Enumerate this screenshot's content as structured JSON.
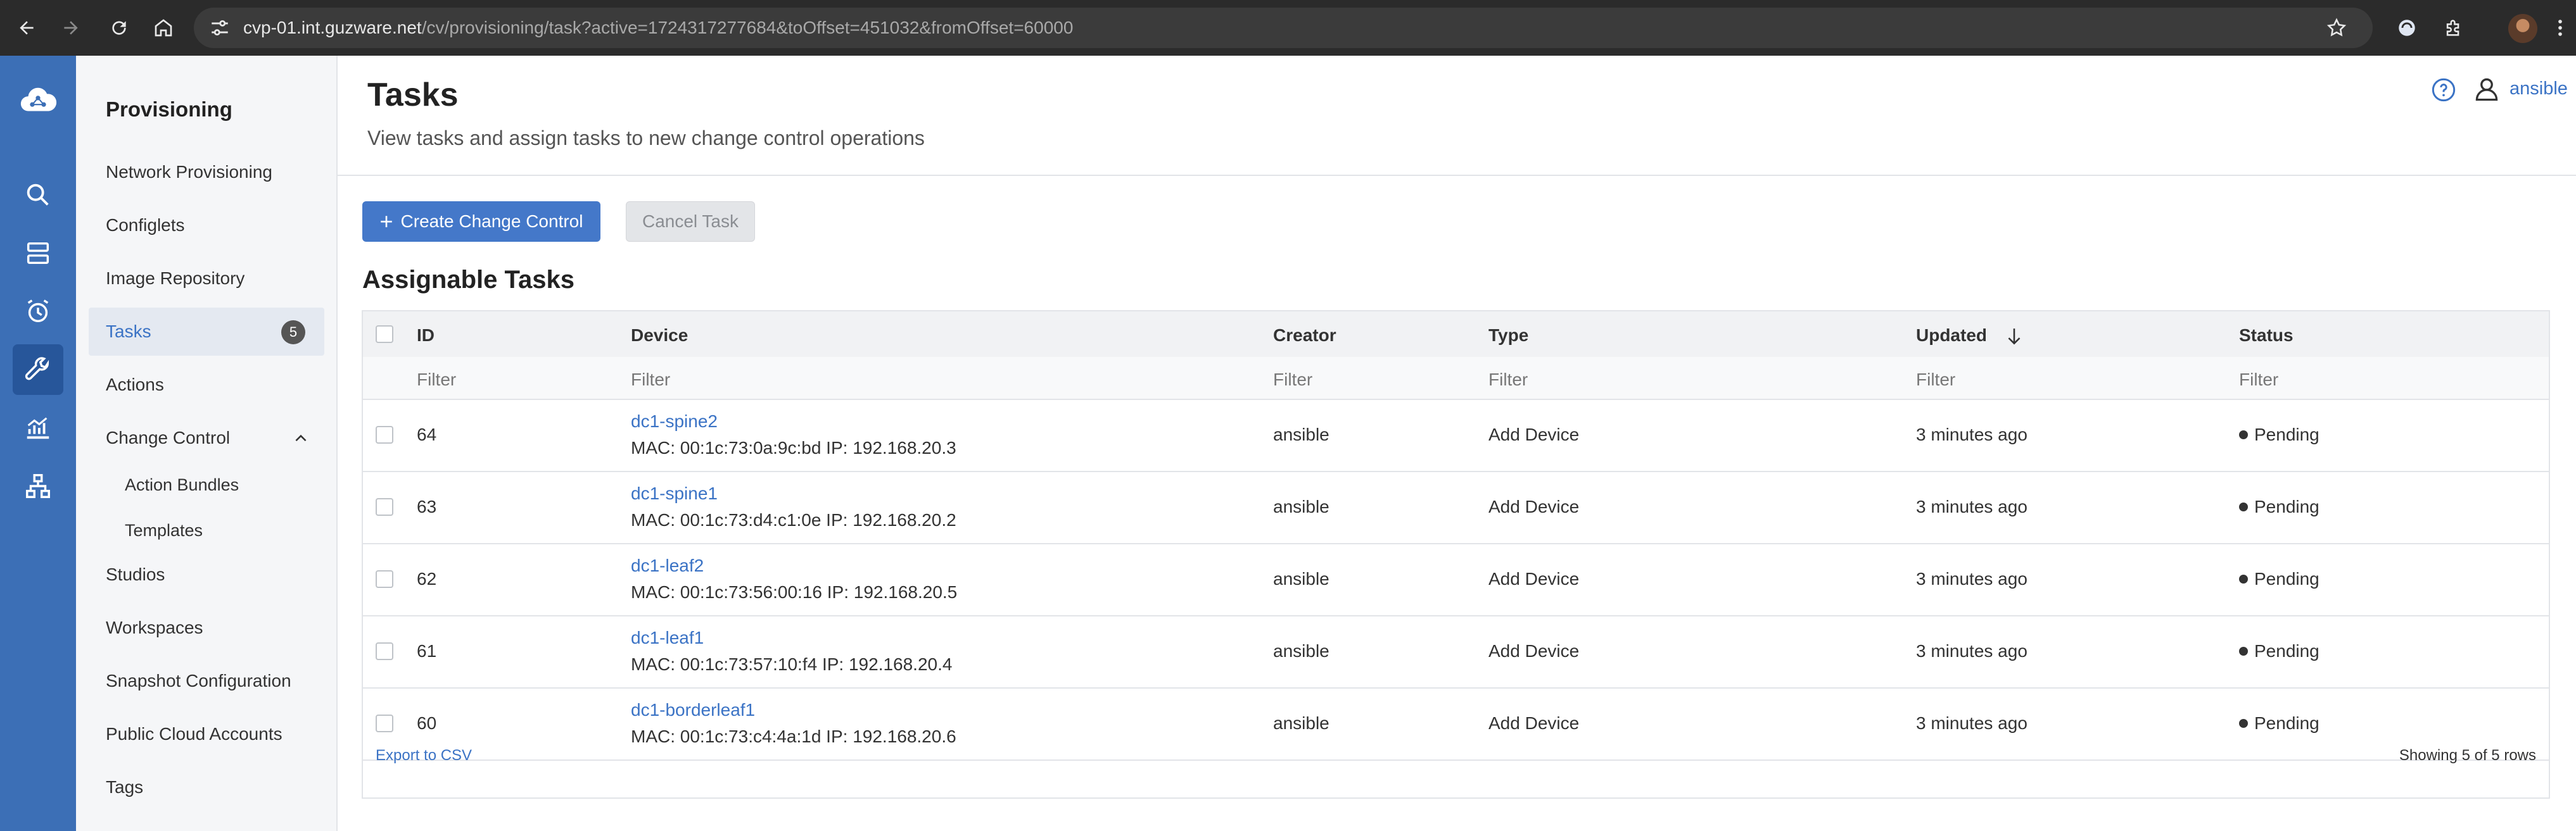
{
  "browser": {
    "url_host": "cvp-01.int.guzware.net",
    "url_path": "/cv/provisioning/task?active=1724317277684&toOffset=451032&fromOffset=60000"
  },
  "rail": {
    "icons": [
      "cloud-logo-icon",
      "search-icon",
      "devices-icon",
      "alarm-clock-icon",
      "wrench-icon",
      "metrics-icon",
      "topology-icon"
    ]
  },
  "sidebar": {
    "title": "Provisioning",
    "items": [
      {
        "label": "Network Provisioning"
      },
      {
        "label": "Configlets"
      },
      {
        "label": "Image Repository"
      },
      {
        "label": "Tasks",
        "badge": "5"
      },
      {
        "label": "Actions"
      },
      {
        "label": "Change Control"
      },
      {
        "label": "Action Bundles"
      },
      {
        "label": "Templates"
      },
      {
        "label": "Studios"
      },
      {
        "label": "Workspaces"
      },
      {
        "label": "Snapshot Configuration"
      },
      {
        "label": "Public Cloud Accounts"
      },
      {
        "label": "Tags"
      }
    ]
  },
  "header": {
    "title": "Tasks",
    "subtitle": "View tasks and assign tasks to new change control operations",
    "user": "ansible"
  },
  "toolbar": {
    "create_label": "Create Change Control",
    "cancel_label": "Cancel Task"
  },
  "section_title": "Assignable Tasks",
  "table": {
    "columns": [
      "ID",
      "Device",
      "Creator",
      "Type",
      "Updated",
      "Status"
    ],
    "filter_placeholder": "Filter",
    "rows": [
      {
        "id": "64",
        "device": "dc1-spine2",
        "meta": "MAC: 00:1c:73:0a:9c:bd IP: 192.168.20.3",
        "creator": "ansible",
        "type": "Add Device",
        "updated": "3 minutes ago",
        "status": "Pending"
      },
      {
        "id": "63",
        "device": "dc1-spine1",
        "meta": "MAC: 00:1c:73:d4:c1:0e IP: 192.168.20.2",
        "creator": "ansible",
        "type": "Add Device",
        "updated": "3 minutes ago",
        "status": "Pending"
      },
      {
        "id": "62",
        "device": "dc1-leaf2",
        "meta": "MAC: 00:1c:73:56:00:16 IP: 192.168.20.5",
        "creator": "ansible",
        "type": "Add Device",
        "updated": "3 minutes ago",
        "status": "Pending"
      },
      {
        "id": "61",
        "device": "dc1-leaf1",
        "meta": "MAC: 00:1c:73:57:10:f4 IP: 192.168.20.4",
        "creator": "ansible",
        "type": "Add Device",
        "updated": "3 minutes ago",
        "status": "Pending"
      },
      {
        "id": "60",
        "device": "dc1-borderleaf1",
        "meta": "MAC: 00:1c:73:c4:4a:1d IP: 192.168.20.6",
        "creator": "ansible",
        "type": "Add Device",
        "updated": "3 minutes ago",
        "status": "Pending"
      }
    ],
    "export_label": "Export to CSV",
    "rows_count": "Showing 5 of 5 rows"
  },
  "colors": {
    "rail": "#3c6fb6",
    "accent": "#4478c9",
    "link": "#3b73c5"
  }
}
